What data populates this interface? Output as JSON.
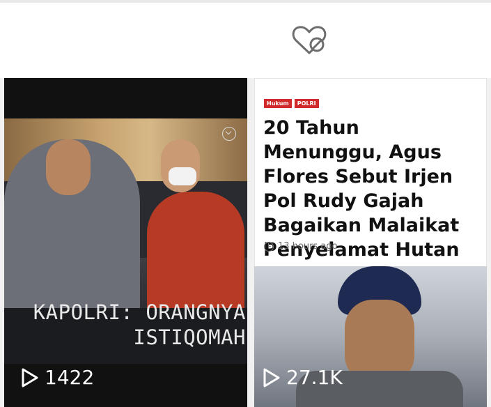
{
  "toolbar": {
    "hidden_icon": "heart-slash-icon"
  },
  "videos": [
    {
      "caption_line1": "KAPOLRI: ORANGNYA",
      "caption_line2": "ISTIQOMAH",
      "views": "1422"
    },
    {
      "tags": [
        "Hukum",
        "POLRI"
      ],
      "headline": "20 Tahun Menunggu, Agus Flores Sebut Irjen Pol Rudy Gajah Bagaikan Malaikat Penyelamat Hutan",
      "time": "13 hours ago",
      "views": "27.1K"
    }
  ],
  "colors": {
    "tag_red": "#d12a2a",
    "accent_text": "#111111"
  }
}
